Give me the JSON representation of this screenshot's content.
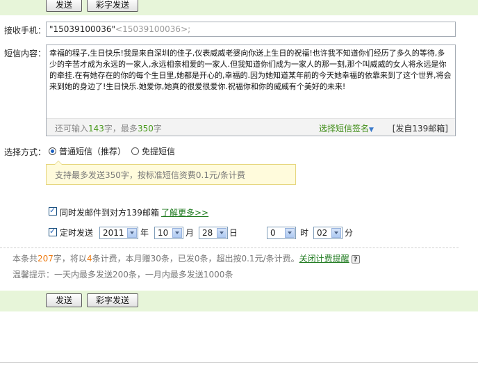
{
  "buttons": {
    "send": "发送",
    "colorful_send": "彩字发送"
  },
  "receiver": {
    "label": "接收手机：",
    "value_name": "\"15039100036\"",
    "value_addr": "<15039100036>;"
  },
  "message": {
    "label": "短信内容：",
    "content": "幸福的程子,生日快乐!我是来自深圳的佳子,仪表威威老婆向你送上生日的祝福!也许我不知道你们经历了多久的等待,多少的辛苦才成为永远的一家人,永远相亲相爱的一家人.但我知道你们成为一家人的那一刻,那个叫威威的女人将永远是你的牵挂.在有她存在的你的每个生日里,她都是开心的,幸福的.因为她知道某年前的今天她幸福的依靠来到了这个世界,将会来到她的身边了!生日快乐.她爱你,她真的很爱很爱你.祝福你和你的威威有个美好的未来!",
    "remaining_prefix": "还可输入",
    "remaining_count": "143",
    "remaining_mid": "字，最多",
    "max_count": "350",
    "remaining_suffix": "字",
    "signature_label": "选择短信签名",
    "mailbox_label": "[发自139邮箱]"
  },
  "send_method": {
    "label": "选择方式：",
    "option_normal": "普通短信（推荐）",
    "option_free": "免提短信",
    "tip": "支持最多发送350字，按标准短信资费0.1元/条计费"
  },
  "email_sync": {
    "label": "同时发邮件到对方139邮箱",
    "link": "了解更多>>"
  },
  "schedule": {
    "label": "定时发送",
    "year": "2011",
    "year_unit": "年",
    "month": "10",
    "month_unit": "月",
    "day": "28",
    "day_unit": "日",
    "hour": "0",
    "hour_unit": "时",
    "minute": "02",
    "minute_unit": "分"
  },
  "billing": {
    "p1": "本条共",
    "chars": "207",
    "p2": "字，将以",
    "parts": "4",
    "p3": "条计费，本月赠30条，已发0条，超出按0.1元/条计费。",
    "link": "关闭计费提醒",
    "help": "?"
  },
  "warm_tip": "温馨提示：一天内最多发送200条，一月内最多发送1000条",
  "colors": {
    "band": "#e7f5d9",
    "link_green": "#1f7a1f",
    "highlight_orange": "#ee7b12"
  }
}
